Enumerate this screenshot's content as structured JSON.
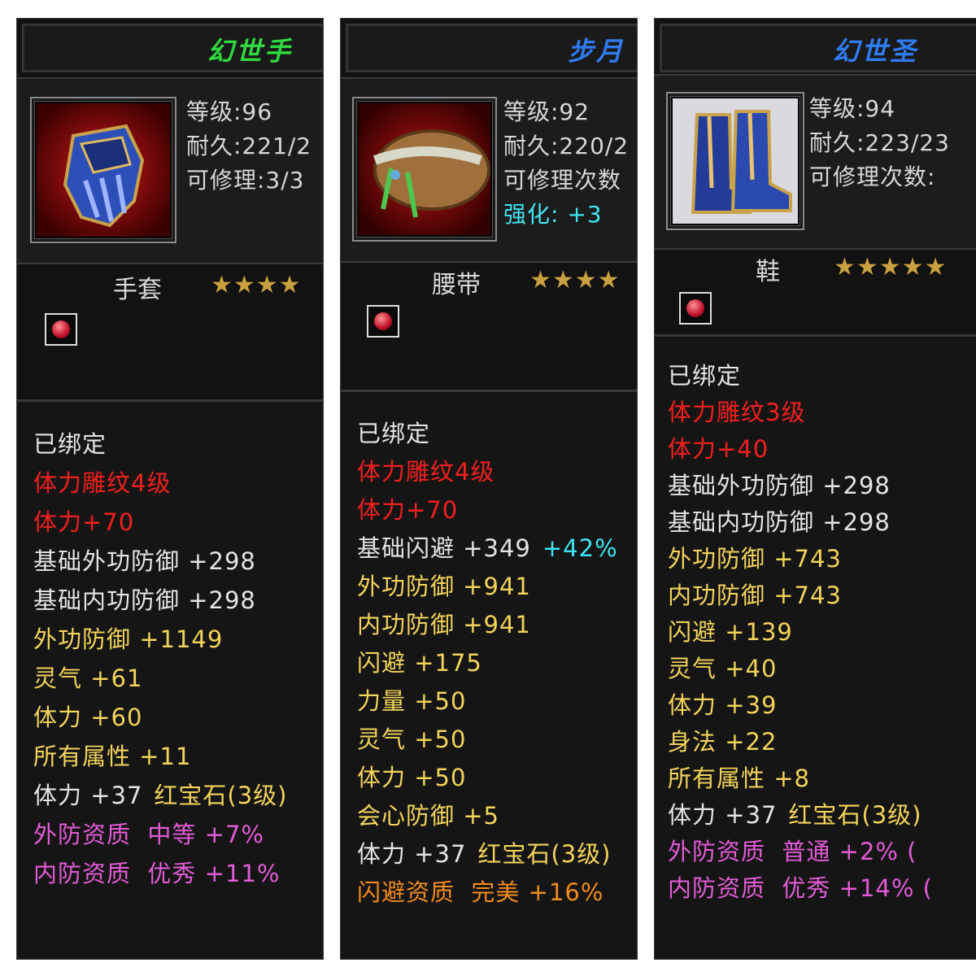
{
  "panels": [
    {
      "title": "幻世手",
      "title_color": "#2fd93f",
      "stats": [
        "等级:96",
        "耐久:221/2",
        "可修理:3/3"
      ],
      "enhance": null,
      "item_type": "手套",
      "stars": "★★★★",
      "attributes": [
        {
          "text": "已绑定",
          "color": "white"
        },
        {
          "text": "体力雕纹4级",
          "color": "red"
        },
        {
          "text": "体力+70",
          "color": "red"
        },
        {
          "text": "基础外功防御 +298",
          "color": "white"
        },
        {
          "text": "基础内功防御 +298",
          "color": "white"
        },
        {
          "text": "外功防御 +1149",
          "color": "yellow"
        },
        {
          "text": "灵气 +61",
          "color": "yellow"
        },
        {
          "text": "体力 +60",
          "color": "yellow"
        },
        {
          "text": "所有属性 +11",
          "color": "yellow"
        },
        {
          "text": "体力 +37",
          "color": "white",
          "extra": "红宝石(3级)",
          "extra_color": "yellow"
        },
        {
          "text": "外防资质  中等 +7%",
          "color": "pink"
        },
        {
          "text": "内防资质  优秀 +11%",
          "color": "pink"
        }
      ]
    },
    {
      "title": "步月",
      "title_color": "#2f7bf0",
      "stats": [
        "等级:92",
        "耐久:220/2",
        "可修理次数"
      ],
      "enhance": "强化: +3",
      "item_type": "腰带",
      "stars": "★★★★",
      "attributes": [
        {
          "text": "已绑定",
          "color": "white"
        },
        {
          "text": "体力雕纹4级",
          "color": "red"
        },
        {
          "text": "体力+70",
          "color": "red"
        },
        {
          "text": "基础闪避 +349",
          "color": "white",
          "extra": "+42%",
          "extra_color": "cyan"
        },
        {
          "text": "外功防御 +941",
          "color": "yellow"
        },
        {
          "text": "内功防御 +941",
          "color": "yellow"
        },
        {
          "text": "闪避 +175",
          "color": "yellow"
        },
        {
          "text": "力量 +50",
          "color": "yellow"
        },
        {
          "text": "灵气 +50",
          "color": "yellow"
        },
        {
          "text": "体力 +50",
          "color": "yellow"
        },
        {
          "text": "会心防御 +5",
          "color": "yellow"
        },
        {
          "text": "体力 +37",
          "color": "white",
          "extra": "红宝石(3级)",
          "extra_color": "yellow"
        },
        {
          "text": "闪避资质  完美 +16%",
          "color": "orange"
        }
      ]
    },
    {
      "title": "幻世圣",
      "title_color": "#2f7bf0",
      "stats": [
        "等级:94",
        "耐久:223/23",
        "可修理次数:"
      ],
      "enhance": null,
      "item_type": "鞋",
      "stars": "★★★★★",
      "attributes": [
        {
          "text": "已绑定",
          "color": "white"
        },
        {
          "text": "体力雕纹3级",
          "color": "red"
        },
        {
          "text": "体力+40",
          "color": "red"
        },
        {
          "text": "基础外功防御 +298",
          "color": "white"
        },
        {
          "text": "基础内功防御 +298",
          "color": "white"
        },
        {
          "text": "外功防御 +743",
          "color": "yellow"
        },
        {
          "text": "内功防御 +743",
          "color": "yellow"
        },
        {
          "text": "闪避 +139",
          "color": "yellow"
        },
        {
          "text": "灵气 +40",
          "color": "yellow"
        },
        {
          "text": "体力 +39",
          "color": "yellow"
        },
        {
          "text": "身法 +22",
          "color": "yellow"
        },
        {
          "text": "所有属性 +8",
          "color": "yellow"
        },
        {
          "text": "体力 +37",
          "color": "white",
          "extra": "红宝石(3级)",
          "extra_color": "yellow"
        },
        {
          "text": "外防资质  普通 +2% (",
          "color": "pink"
        },
        {
          "text": "内防资质  优秀 +14% (",
          "color": "pink"
        }
      ]
    }
  ]
}
